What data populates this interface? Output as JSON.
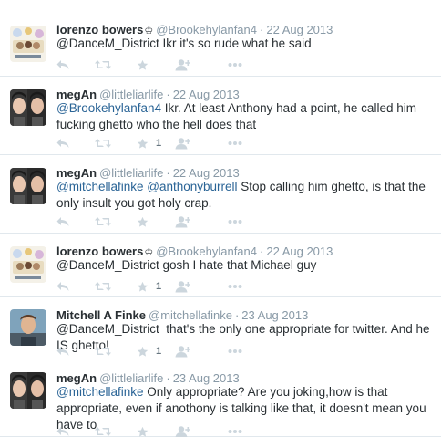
{
  "tweets": [
    {
      "fullname": "lorenzo bowers",
      "badge": "♔",
      "username": "@Brookehylanfan4",
      "date": "22 Aug 2013",
      "text_parts": [
        {
          "type": "plain",
          "text": "@DanceM_District Ikr it's so rude what he said"
        }
      ],
      "favorites": "",
      "avatar": "lorenzo"
    },
    {
      "fullname": "megAn",
      "username": "@littleliarlife",
      "date": "22 Aug 2013",
      "text_parts": [
        {
          "type": "mention",
          "text": "@Brookehylanfan4"
        },
        {
          "type": "plain",
          "text": " Ikr. At least Anthony had a point, he called him fucking ghetto who the hell does that"
        }
      ],
      "favorites": "1",
      "avatar": "megan"
    },
    {
      "fullname": "megAn",
      "username": "@littleliarlife",
      "date": "22 Aug 2013",
      "text_parts": [
        {
          "type": "mention",
          "text": "@mitchellafinke"
        },
        {
          "type": "plain",
          "text": " "
        },
        {
          "type": "mention",
          "text": "@anthonyburrell"
        },
        {
          "type": "plain",
          "text": " Stop calling him ghetto, is that the only insult you got holy crap."
        }
      ],
      "favorites": "",
      "avatar": "megan"
    },
    {
      "fullname": "lorenzo bowers",
      "badge": "♔",
      "username": "@Brookehylanfan4",
      "date": "22 Aug 2013",
      "text_parts": [
        {
          "type": "plain",
          "text": "@DanceM_District gosh I hate that Michael guy"
        }
      ],
      "favorites": "1",
      "avatar": "lorenzo"
    },
    {
      "fullname": "Mitchell A Finke",
      "username": "@mitchellafinke",
      "date": "23 Aug 2013",
      "text_parts": [
        {
          "type": "plain",
          "text": "@DanceM_District  that's the only one appropriate for twitter. And he IS ghetto!"
        }
      ],
      "favorites": "1",
      "avatar": "mitchell"
    },
    {
      "fullname": "megAn",
      "username": "@littleliarlife",
      "date": "23 Aug 2013",
      "text_parts": [
        {
          "type": "mention",
          "text": "@mitchellafinke"
        },
        {
          "type": "plain",
          "text": " Only appropriate? Are you joking,how is that appropriate, even if anothony is talking like that, it doesn't mean you have to"
        }
      ],
      "favorites": "",
      "avatar": "megan"
    }
  ],
  "date_separator": "·",
  "icons": {
    "reply": "reply-icon",
    "retweet": "retweet-icon",
    "favorite": "star-icon",
    "follow": "follow-user-icon",
    "more": "more-dots-icon"
  },
  "colors": {
    "mention": "#2a6496",
    "meta": "#8899a6",
    "action_icon": "#ccd6dd"
  }
}
